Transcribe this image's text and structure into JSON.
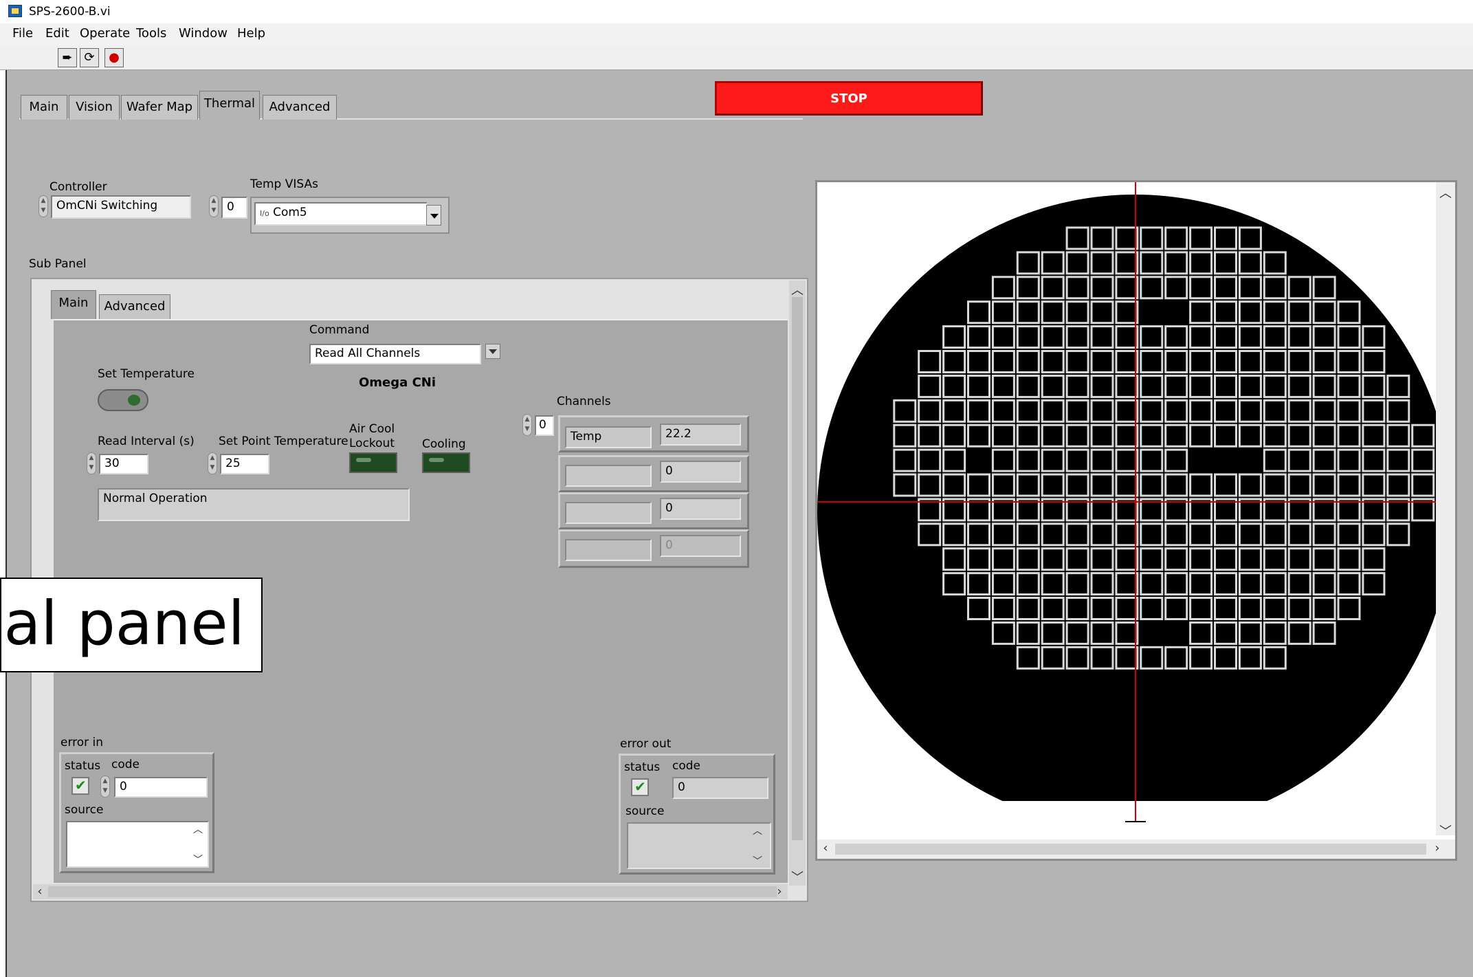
{
  "window": {
    "title": "SPS-2600-B.vi"
  },
  "menu": [
    "File",
    "Edit",
    "Operate",
    "Tools",
    "Window",
    "Help"
  ],
  "toolbar": {
    "run": "➨",
    "run_continuous": "⟳",
    "abort": "●"
  },
  "tabs": [
    "Main",
    "Vision",
    "Wafer Map",
    "Thermal",
    "Advanced"
  ],
  "active_tab": "Thermal",
  "stop_label": "STOP",
  "controller": {
    "label": "Controller",
    "value": "OmCNi Switching"
  },
  "temp_visas": {
    "label": "Temp VISAs",
    "index": "0",
    "prefix": "I/o",
    "value": "Com5"
  },
  "sub_panel": {
    "label": "Sub Panel",
    "tabs": [
      "Main",
      "Advanced"
    ],
    "command": {
      "label": "Command",
      "value": "Read All Channels"
    },
    "device_name": "Omega CNi",
    "set_temperature_label": "Set Temperature",
    "read_interval": {
      "label": "Read Interval (s)",
      "value": "30"
    },
    "set_point": {
      "label": "Set Point Temperature",
      "value": "25"
    },
    "air_cool_lockout": "Air Cool\nLockout",
    "cooling": "Cooling",
    "status_text": "Normal Operation",
    "channels": {
      "label": "Channels",
      "index": "0",
      "rows": [
        {
          "name": "Temp",
          "value": "22.2"
        },
        {
          "name": "",
          "value": "0"
        },
        {
          "name": "",
          "value": "0"
        },
        {
          "name": "",
          "value": "0"
        }
      ]
    },
    "error_in": {
      "label": "error in",
      "status_label": "status",
      "code_label": "code",
      "code": "0",
      "source_label": "source",
      "source": ""
    },
    "error_out": {
      "label": "error out",
      "status_label": "status",
      "code_label": "code",
      "code": "0",
      "source_label": "source",
      "source": ""
    }
  },
  "callout_text": "Thermal panel",
  "colors": {
    "panel": "#b4b4b4",
    "stop": "#ff1a1a",
    "highlight_die": "#ffe600",
    "crosshair": "#cc0000"
  }
}
